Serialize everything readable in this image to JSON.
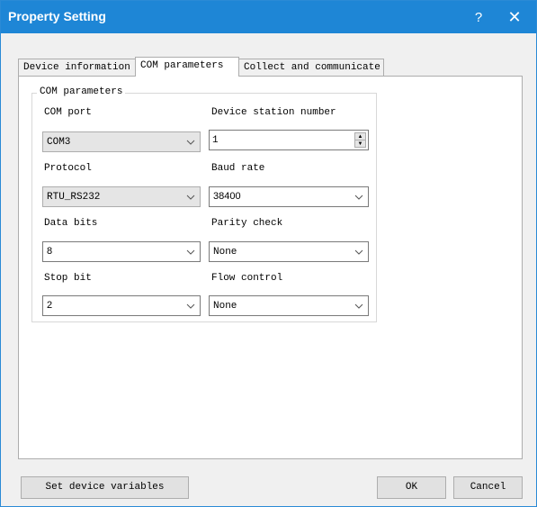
{
  "window": {
    "title": "Property Setting",
    "help_label": "?",
    "close_label": "✕",
    "title_bar_color": "#1e86d6"
  },
  "tabs": [
    {
      "label": "Device information",
      "active": false
    },
    {
      "label": "COM parameters",
      "active": true
    },
    {
      "label": "Collect and communicate",
      "active": false
    }
  ],
  "group": {
    "title": "COM parameters",
    "com_port": {
      "label": "COM port",
      "value": "COM3"
    },
    "station": {
      "label": "Device station number",
      "value": "1"
    },
    "protocol": {
      "label": "Protocol",
      "value": "RTU_RS232"
    },
    "baud": {
      "label": "Baud rate",
      "value": "38400"
    },
    "data_bits": {
      "label": "Data bits",
      "value": "8"
    },
    "parity": {
      "label": "Parity check",
      "value": "None"
    },
    "stop_bit": {
      "label": "Stop bit",
      "value": "2"
    },
    "flow": {
      "label": "Flow control",
      "value": "None"
    }
  },
  "buttons": {
    "set_vars": "Set device variables",
    "ok": "OK",
    "cancel": "Cancel"
  },
  "icons": {
    "help": "help-icon",
    "close": "close-icon",
    "dropdown": "chevron-down-icon",
    "spin_up": "spin-up-icon",
    "spin_down": "spin-down-icon"
  }
}
